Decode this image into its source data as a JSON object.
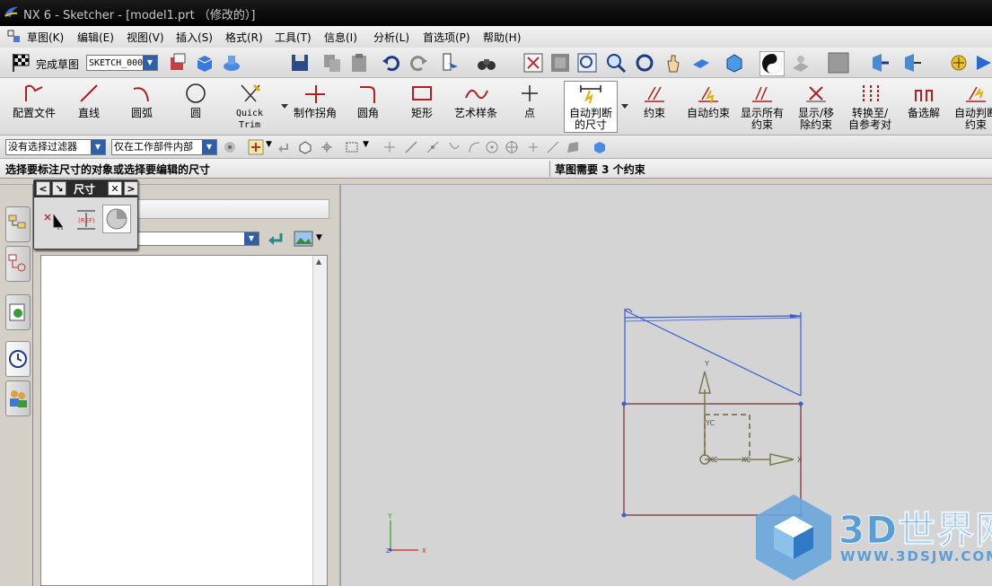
{
  "window": {
    "title": "NX 6 - Sketcher - [model1.prt （修改的）]"
  },
  "menubar": {
    "items": [
      "草图(K)",
      "编辑(E)",
      "视图(V)",
      "插入(S)",
      "格式(R)",
      "工具(T)",
      "信息(I)",
      "分析(L)",
      "首选项(P)",
      "帮助(H)"
    ]
  },
  "toolbar1": {
    "finish_sketch": "完成草图",
    "sketch_name": "SKETCH_000"
  },
  "sketch_tools": [
    {
      "label": "配置文件",
      "icon": "profile-icon"
    },
    {
      "label": "直线",
      "icon": "line-icon"
    },
    {
      "label": "圆弧",
      "icon": "arc-icon"
    },
    {
      "label": "圆",
      "icon": "circle-icon"
    },
    {
      "label": "Quick\nTrim",
      "icon": "quick-trim-icon"
    },
    {
      "label": "制作拐角",
      "icon": "make-corner-icon"
    },
    {
      "label": "圆角",
      "icon": "fillet-icon"
    },
    {
      "label": "矩形",
      "icon": "rectangle-icon"
    },
    {
      "label": "艺术样条",
      "icon": "spline-icon"
    },
    {
      "label": "点",
      "icon": "point-icon"
    },
    {
      "label": "自动判断\n的尺寸",
      "icon": "inferred-dimension-icon"
    },
    {
      "label": "约束",
      "icon": "constraints-icon"
    },
    {
      "label": "自动约束",
      "icon": "auto-constrain-icon"
    },
    {
      "label": "显示所有\n约束",
      "icon": "show-all-constraints-icon"
    },
    {
      "label": "显示/移\n除约束",
      "icon": "show-remove-constraints-icon"
    },
    {
      "label": "转换至/\n自参考对",
      "icon": "convert-reference-icon"
    },
    {
      "label": "备选解",
      "icon": "alternate-solution-icon"
    },
    {
      "label": "自动判断\n约束",
      "icon": "inferred-constraints-icon"
    }
  ],
  "selection_bar": {
    "filter": "没有选择过滤器",
    "scope": "仅在工作部件内部"
  },
  "status": {
    "prompt": "选择要标注尺寸的对象或选择要编辑的尺寸",
    "message": "草图需要 3 个约束"
  },
  "dimension_popup": {
    "title": "尺寸"
  },
  "canvas_labels": {
    "y": "Y",
    "yc": "YC",
    "xc": "XC",
    "x": "X",
    "wcs_y": "Y",
    "wcs_z": "Z",
    "wcs_x": "X"
  },
  "watermark": {
    "brand": "3D世界网",
    "url": "WWW.3DSJW.COM"
  },
  "colors": {
    "sketch_blue": "#3a5fd0",
    "sketch_maroon": "#8b4a4a",
    "datum_olive": "#7a7a4a",
    "accent_bar": "#2f5fa8"
  }
}
